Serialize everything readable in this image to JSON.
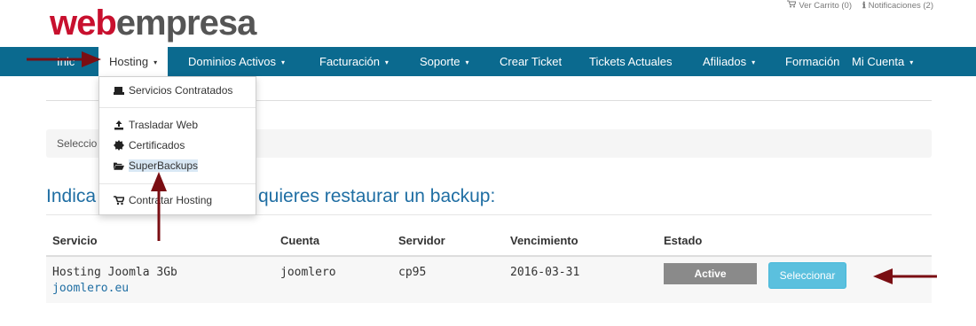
{
  "brand": {
    "part1": "web",
    "part2": "empresa"
  },
  "top_links": [
    {
      "icon": "cart-icon",
      "label": "Ver Carrito (0)"
    },
    {
      "icon": "info-icon",
      "label": "Notificaciones (2)"
    }
  ],
  "nav": {
    "items": [
      {
        "label": "Inic"
      },
      {
        "label": "Hosting",
        "caret": "▾"
      },
      {
        "label": "Dominios Activos",
        "caret": "▾"
      },
      {
        "label": "Facturación",
        "caret": "▾"
      },
      {
        "label": "Soporte",
        "caret": "▾"
      },
      {
        "label": "Crear Ticket"
      },
      {
        "label": "Tickets Actuales"
      },
      {
        "label": "Afiliados",
        "caret": "▾"
      },
      {
        "label": "Formación"
      },
      {
        "label": "Mi Cuenta",
        "caret": "▾"
      }
    ]
  },
  "dropdown": {
    "items": [
      {
        "icon": "hdd-icon",
        "label": "Servicios Contratados"
      },
      {
        "icon": "upload-icon",
        "label": "Trasladar Web"
      },
      {
        "icon": "certificate-icon",
        "label": "Certificados"
      },
      {
        "icon": "folder-open-icon",
        "label": "SuperBackups"
      },
      {
        "icon": "cart-icon",
        "label": "Contratar Hosting"
      }
    ]
  },
  "select_band": {
    "text": "Seleccio"
  },
  "heading": {
    "left": "Indica",
    "right": "quieres restaurar un backup:"
  },
  "table": {
    "headers": [
      "Servicio",
      "Cuenta",
      "Servidor",
      "Vencimiento",
      "Estado"
    ],
    "rows": [
      {
        "servicio": "Hosting Joomla 3Gb",
        "dominio": "joomlero.eu",
        "cuenta": "joomlero",
        "servidor": "cp95",
        "vencimiento": "2016-03-31",
        "estado": "Active",
        "accion": "Seleccionar"
      }
    ]
  },
  "colors": {
    "navbar": "#0b6a8f",
    "brand_red": "#c8102e",
    "brand_gray": "#555555",
    "link_blue": "#1f6ea3",
    "button_info": "#5bc0de",
    "status_gray": "#8a8a8a",
    "arrow": "#7a0e13"
  }
}
